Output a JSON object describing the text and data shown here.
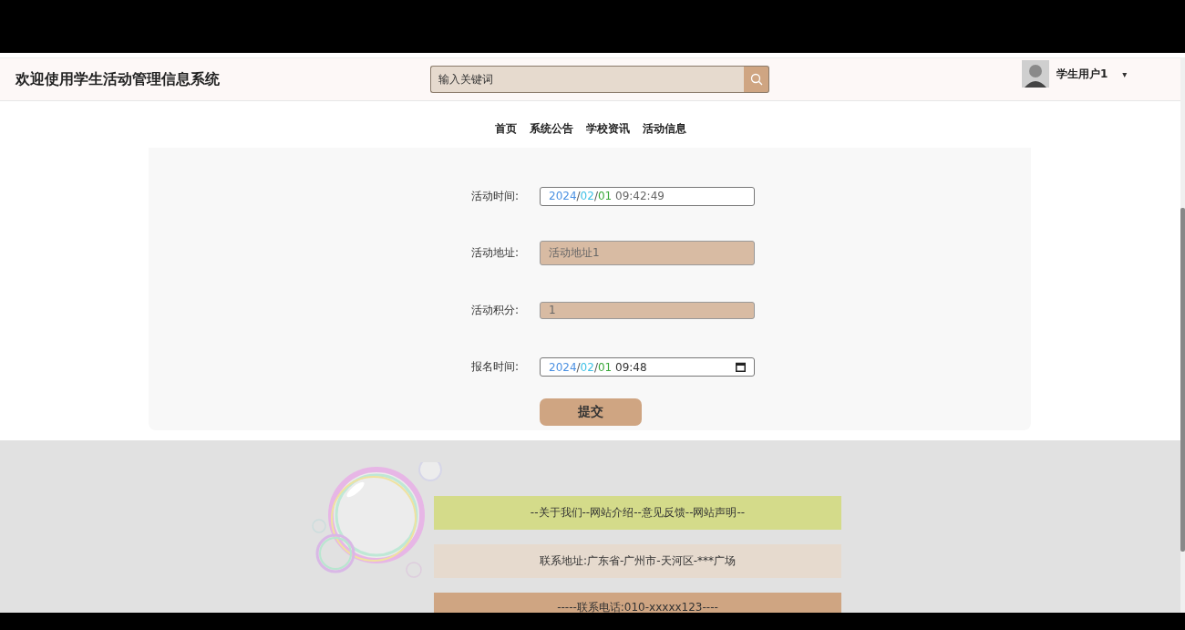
{
  "header": {
    "title": "欢迎使用学生活动管理信息系统",
    "search": {
      "placeholder": "输入关键词"
    },
    "user": {
      "name": "学生用户1",
      "caret": "▾"
    }
  },
  "nav": [
    {
      "label": "首页"
    },
    {
      "label": "系统公告"
    },
    {
      "label": "学校资讯"
    },
    {
      "label": "活动信息"
    }
  ],
  "form": {
    "fields": [
      {
        "label": "活动时间:",
        "kind": "datetime",
        "readonly": false,
        "parts": [
          {
            "text": "2024",
            "color": "#4a90e2"
          },
          {
            "text": "/"
          },
          {
            "text": "02",
            "color": "#3fc1e6"
          },
          {
            "text": "/"
          },
          {
            "text": "01",
            "color": "#3aa83a"
          },
          {
            "text": " 09:42:49",
            "color": "#666666"
          }
        ]
      },
      {
        "label": "活动地址:",
        "kind": "text",
        "readonly": true,
        "value": "活动地址1"
      },
      {
        "label": "活动积分:",
        "kind": "text",
        "readonly": true,
        "value": "1"
      },
      {
        "label": "报名时间:",
        "kind": "datetime-picker",
        "readonly": false,
        "parts": [
          {
            "text": "2024",
            "color": "#4a90e2"
          },
          {
            "text": "/"
          },
          {
            "text": "02",
            "color": "#3fc1e6"
          },
          {
            "text": "/"
          },
          {
            "text": "01",
            "color": "#3aa83a"
          },
          {
            "text": " 09:48",
            "color": "#333333"
          }
        ]
      }
    ],
    "submit": "提交"
  },
  "footer": {
    "rows": [
      {
        "text": "--关于我们--网站介绍--意见反馈--网站声明--",
        "color": "#d4db8a"
      },
      {
        "text": "联系地址:广东省-广州市-天河区-***广场",
        "color": "#e6dace"
      },
      {
        "text": "-----联系电话:010-xxxxx123----",
        "color": "#cfa582"
      }
    ]
  }
}
